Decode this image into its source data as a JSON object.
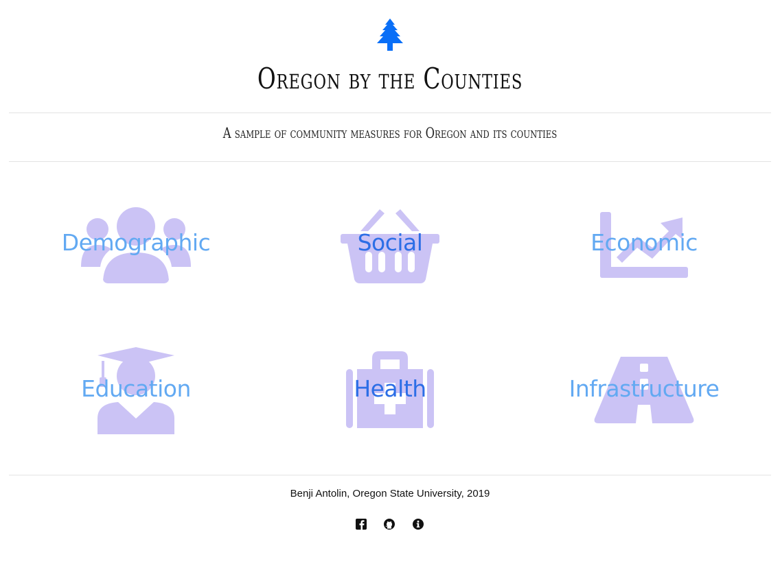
{
  "header": {
    "title": "Oregon by the Counties",
    "subtitle": "A sample of community measures for Oregon and its counties",
    "logo_icon": "tree-icon"
  },
  "categories": [
    {
      "label": "Demographic",
      "icon": "users-icon"
    },
    {
      "label": "Social",
      "icon": "shopping-basket-icon"
    },
    {
      "label": "Economic",
      "icon": "chart-line-icon"
    },
    {
      "label": "Education",
      "icon": "graduate-icon"
    },
    {
      "label": "Health",
      "icon": "medical-kit-icon"
    },
    {
      "label": "Infrastructure",
      "icon": "road-icon"
    }
  ],
  "footer": {
    "credit": "Benji Antolin, Oregon State University, 2019",
    "links": [
      {
        "icon": "facebook-icon"
      },
      {
        "icon": "github-icon"
      },
      {
        "icon": "info-icon"
      }
    ]
  },
  "colors": {
    "accent": "#0a6ff7",
    "icon_fill": "#cbc3f5",
    "label_light": "#62a9f2",
    "label_dark": "#2c6ee6",
    "rule": "#e3e3e3"
  }
}
